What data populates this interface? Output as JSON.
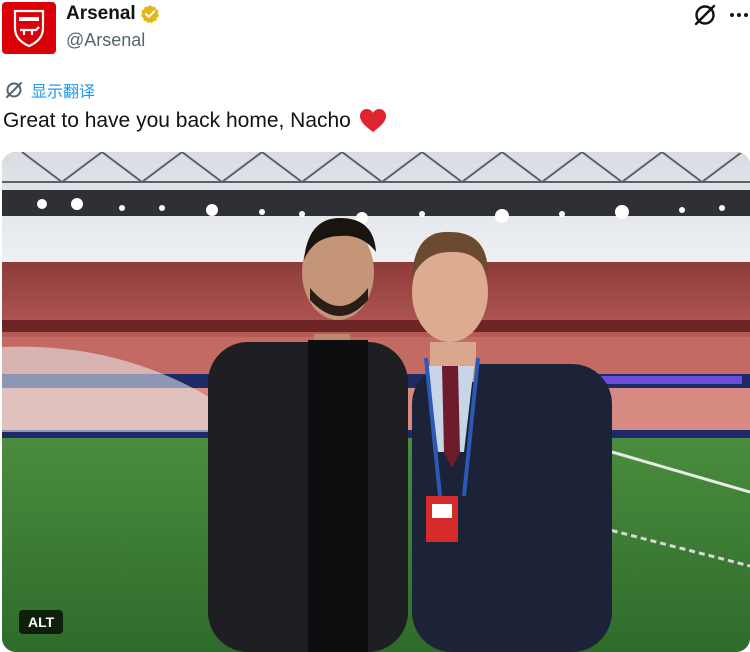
{
  "author": {
    "display_name": "Arsenal",
    "handle": "@Arsenal",
    "verified_color": "#e2b719",
    "avatar_color": "#db0007"
  },
  "actions": {
    "grok_icon": "grok-icon",
    "more_icon": "more-icon"
  },
  "translate": {
    "label": "显示翻译"
  },
  "tweet": {
    "text": "Great to have you back home, Nacho",
    "emoji_color": "#e0242f"
  },
  "media": {
    "alt_label": "ALT"
  }
}
